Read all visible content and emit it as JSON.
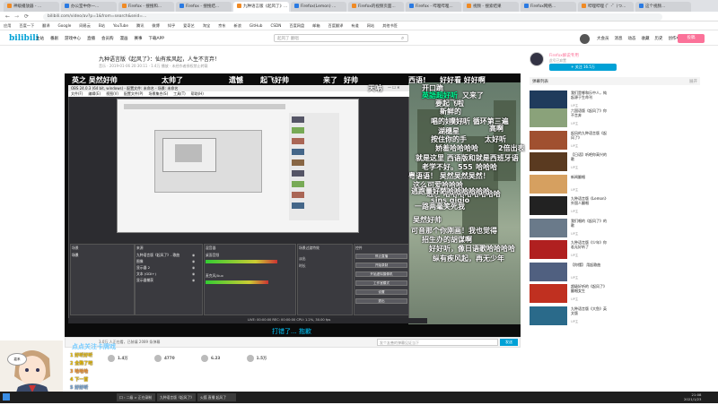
{
  "browser": {
    "tabs": [
      "神级播放器 - ...",
      "办公室中你一...",
      "Firefox - 搜搜和...",
      "Firefox - 搜搜结...",
      "九种语言版《起风了》...",
      "Firefox(Lemon) ...",
      "Firefox的视频页面...",
      "Firefox - 哔哩哔哩...",
      "视频 - 搜索结果",
      "Firefox网络...",
      "哔哩哔哩 (゜-゜)つ...",
      "这个视频..."
    ],
    "url": "bilibili.com/video/av?p=1&from=search&seid=...",
    "bookmarks": [
      "应用",
      "百度一下",
      "翻译",
      "Google",
      "网易云",
      "B站",
      "YouTube",
      "腾讯",
      "微博",
      "知乎",
      "爱奇艺",
      "淘宝",
      "京东",
      "新浪",
      "GitHub",
      "CSDN",
      "百度网盘",
      "邮箱",
      "百度翻译",
      "有道",
      "网站",
      "其他书签"
    ]
  },
  "header": {
    "logo": "bilibili",
    "nav": [
      "主站",
      "番剧",
      "游戏中心",
      "直播",
      "会员购",
      "漫画",
      "赛事",
      "下载APP"
    ],
    "search_placeholder": "起风了 翻唱",
    "right_nav": [
      "大会员",
      "消息",
      "动态",
      "收藏",
      "历史",
      "创作中心"
    ],
    "upload_label": "投稿"
  },
  "video": {
    "title": "九种语言版《起风了》：仙有疾风起，人生不言弃！",
    "meta": "音乐 · 2019-01-06 20:30:11 · 1.4万 播放 · 未经作者授权禁止转载"
  },
  "obs": {
    "title": "OBS 24.0.3 (64 bit, windows) - 配置文件: 未命名 - 场景: 未命名",
    "menu": [
      "文件(F)",
      "编辑(E)",
      "视图(V)",
      "配置文件(P)",
      "场景集合(S)",
      "工具(T)",
      "帮助(H)"
    ],
    "panels": {
      "scenes": "场景",
      "sources": "来源",
      "mixer": "混音器",
      "transitions": "场景过渡特效",
      "controls": "控件"
    },
    "scene_items": [
      "场景"
    ],
    "source_items": [
      "九种语言版《起风了》- 歌曲",
      "图像",
      "显示器 2",
      "文本 (GDI+)",
      "显示器捕获"
    ],
    "mixer_items": [
      "桌面音频",
      "麦克风/Aux"
    ],
    "transition_items": [
      "淡出",
      "时长"
    ],
    "controls": [
      "停止直播",
      "开始录制",
      "开始虚拟摄像机",
      "工作室模式",
      "设置",
      "退出"
    ],
    "status": "LIVE: 00:00:00   REC: 00:00:00   CPU: 1.2%, 30.00 fps"
  },
  "danmaku": [
    {
      "text": "英之 吴然好帅",
      "color": "#ffffff"
    },
    {
      "text": "太帅了",
      "color": "#ffffff"
    },
    {
      "text": "遗憾",
      "color": "#ffffff"
    },
    {
      "text": "起飞好帅",
      "color": "#ffffff"
    },
    {
      "text": "来了",
      "color": "#ffffff"
    },
    {
      "text": "好帅",
      "color": "#ffffff"
    },
    {
      "text": "西语!",
      "color": "#ffffff"
    },
    {
      "text": "好好看 好好啊",
      "color": "#ffffff"
    },
    {
      "text": "开口跪",
      "color": "#ffffff"
    },
    {
      "text": "天呐",
      "color": "#ffffff"
    },
    {
      "text": "英語超好听",
      "color": "#00ff99"
    },
    {
      "text": "又来了",
      "color": "#ffffff"
    },
    {
      "text": "要起飞啦",
      "color": "#ffffff"
    },
    {
      "text": "新鲜的",
      "color": "#ffffff"
    },
    {
      "text": "唱的好好听",
      "color": "#ffffff"
    },
    {
      "text": "噗好听 循环第三遍",
      "color": "#ffffff"
    },
    {
      "text": "高啊",
      "color": "#ffffff"
    },
    {
      "text": "湖穗星",
      "color": "#ffffff"
    },
    {
      "text": "按住你的手",
      "color": "#ffffff"
    },
    {
      "text": "太好听",
      "color": "#ffffff"
    },
    {
      "text": "娇羞哈哈哈哈",
      "color": "#ffffff"
    },
    {
      "text": "2倍出表",
      "color": "#ffffff"
    },
    {
      "text": "就是这里 西语版和就是西班牙语",
      "color": "#ffffff"
    },
    {
      "text": "老学不好。555",
      "color": "#ffffff"
    },
    {
      "text": "哈哈哈",
      "color": "#ffffff"
    },
    {
      "text": "粤语语！ 吴然吴然吴然！",
      "color": "#ffffff"
    },
    {
      "text": "这么可爱哈哈哈",
      "color": "#ffffff"
    },
    {
      "text": "逃亡 哈哈哈哈哈哈哈哈",
      "color": "#ffffff"
    },
    {
      "text": "逃跑量好萨哈哈哈哈哈哈",
      "color": "#ffffff"
    },
    {
      "text": "sins gigio",
      "color": "#ffffff"
    },
    {
      "text": "一路两毫笑死我",
      "color": "#ffffff"
    },
    {
      "text": "吴然好帅",
      "color": "#ffffff"
    },
    {
      "text": "可音那个你刚画！我也觉得",
      "color": "#ffffff"
    },
    {
      "text": "招生办的胡谋啊",
      "color": "#ffffff"
    },
    {
      "text": "好好听，像日语歌哈哈哈哈",
      "color": "#ffffff"
    },
    {
      "text": "纵有疾风起，再无少年",
      "color": "#ffffff"
    }
  ],
  "subtitle": "打错了... 抱歉",
  "player": {
    "viewers": "3.0万 人正在看，已装填 2089 条弹幕",
    "dm_placeholder": "发个友善的弹幕见证当下",
    "send_label": "发送"
  },
  "actions": [
    "1.4万",
    "4770",
    "6.23",
    "1.5万"
  ],
  "sidebar": {
    "up_name": "Firefox解说专用",
    "up_desc": "此号已弃置",
    "follow_label": "+ 关注 16.5万",
    "dm_list_label": "弹幕列表",
    "dm_list_action": "展开",
    "autoplay_label": "相关推荐",
    "recommendations": [
      {
        "title": "我们是哪和乐中人，纯起源于生命刊",
        "author": "UP主",
        "color": "#1f3b5c"
      },
      {
        "title": "六国语版《起风了》你不言弃",
        "author": "UP主",
        "color": "#8aa27a"
      },
      {
        "title": "起风的九种语言版《起风了》",
        "author": "UP主",
        "color": "#a05030"
      },
      {
        "title": "【日语】听吧你高兴的歌",
        "author": "UP主",
        "color": "#5a3a20"
      },
      {
        "title": "新闻翻唱",
        "author": "UP主",
        "color": "#d6a060"
      },
      {
        "title": "九种语言版《Lemon》外国人翻唱",
        "author": "UP主",
        "color": "#222222"
      },
      {
        "title": "我们唱的《起风了》的歌",
        "author": "UP主",
        "color": "#6a7a8a"
      },
      {
        "title": "九种语言版《少年》你若无好听了",
        "author": "UP主",
        "color": "#b02020"
      },
      {
        "title": "【你懂】 用起歌曲",
        "author": "UP主",
        "color": "#506080"
      },
      {
        "title": "超级好听的《起风了》翻唱女生",
        "author": "UP主",
        "color": "#c03020"
      },
      {
        "title": "九种语言版《大鱼》英文版",
        "author": "UP主",
        "color": "#2a6a8a"
      }
    ]
  },
  "streamer": {
    "topic": "点点关注卡牌戏",
    "chat": [
      "1 好听好听",
      "2 全熟了吧",
      "3 哈哈哈",
      "4 下一首",
      "5 好好听"
    ]
  },
  "taskbar": {
    "items": [
      "口 ‹ 二级 > 正在录制",
      "九种语言版《起风了》",
      "火狐 直播 起风了"
    ],
    "time": "21:08",
    "date": "2021/1/23"
  }
}
